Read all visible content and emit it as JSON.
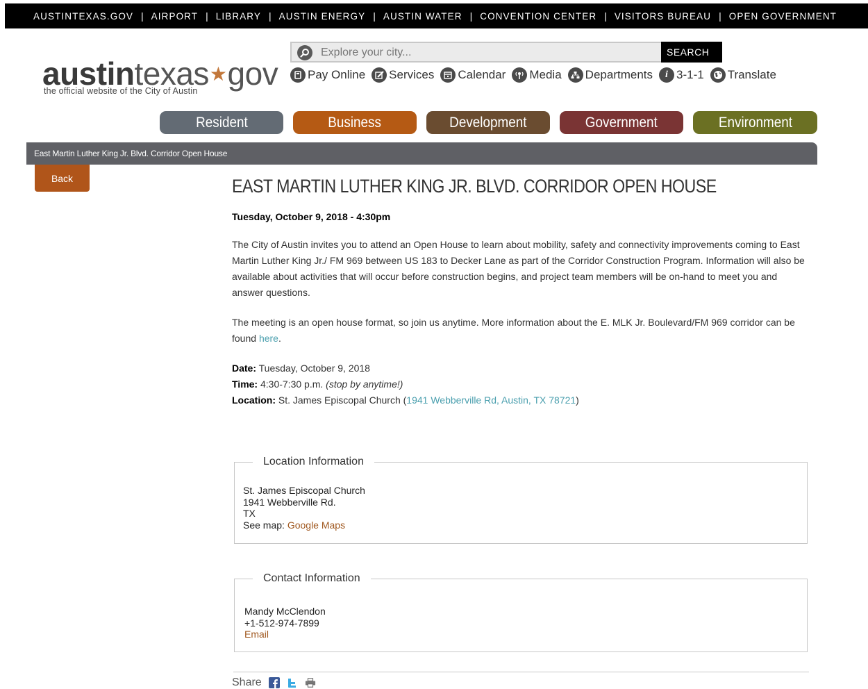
{
  "topbar": {
    "links": [
      "AUSTINTEXAS.GOV",
      "AIRPORT",
      "LIBRARY",
      "AUSTIN ENERGY",
      "AUSTIN WATER",
      "CONVENTION CENTER",
      "VISITORS BUREAU",
      "OPEN GOVERNMENT"
    ],
    "separator": "|"
  },
  "logo": {
    "part1": "austin",
    "part2": "texas",
    "star": "★",
    "part3": "gov",
    "tagline": "the official website of the City of Austin"
  },
  "search": {
    "placeholder": "Explore your city...",
    "button": "SEARCH"
  },
  "quicklinks": [
    {
      "label": "Pay Online",
      "icon": "pay-online-icon"
    },
    {
      "label": "Services",
      "icon": "services-icon"
    },
    {
      "label": "Calendar",
      "icon": "calendar-icon"
    },
    {
      "label": "Media",
      "icon": "media-icon"
    },
    {
      "label": "Departments",
      "icon": "departments-icon"
    },
    {
      "label": "3-1-1",
      "icon": "info-icon"
    },
    {
      "label": "Translate",
      "icon": "globe-icon"
    }
  ],
  "nav": {
    "tabs": [
      {
        "label": "Resident",
        "color": "#636b74"
      },
      {
        "label": "Business",
        "color": "#b55a14"
      },
      {
        "label": "Development",
        "color": "#6a4c30"
      },
      {
        "label": "Government",
        "color": "#7a3434"
      },
      {
        "label": "Environment",
        "color": "#6b7023"
      }
    ]
  },
  "breadcrumb": "East Martin Luther King Jr. Blvd. Corridor Open House",
  "back_button": "Back",
  "event": {
    "title": "EAST MARTIN LUTHER KING JR. BLVD. CORRIDOR OPEN HOUSE",
    "datetime": "Tuesday, October 9, 2018 - 4:30pm",
    "para1": "The City of Austin invites you to attend an Open House to learn about mobility, safety and connectivity improvements coming to East Martin Luther King Jr./ FM 969 between US 183 to Decker Lane as part of the Corridor Construction Program. Information will also be available about activities that will occur before construction begins, and project team members will be on-hand to meet you and answer questions.",
    "para2_text": "The meeting is an open house format, so join us anytime. More information about the E. MLK Jr. Boulevard/FM 969 corridor can be found ",
    "para2_link": "here",
    "para2_end": ".",
    "date_label": "Date:",
    "date_value": " Tuesday, October 9, 2018",
    "time_label": "Time:",
    "time_value": " 4:30-7:30 p.m. ",
    "time_note": "(stop by anytime!)",
    "location_label": "Location:",
    "location_value": " St. James Episcopal Church (",
    "location_link": "1941 Webberville Rd, Austin, TX 78721",
    "location_end": ")"
  },
  "location_info": {
    "legend": "Location Information",
    "name": "St. James Episcopal Church",
    "street": "1941 Webberville Rd.",
    "state": "TX",
    "map_label": "See map: ",
    "map_link": "Google Maps"
  },
  "contact_info": {
    "legend": "Contact Information",
    "name": "Mandy McClendon",
    "phone": "+1-512-974-7899",
    "email_link": "Email"
  },
  "share": {
    "label": "Share",
    "icons": [
      "facebook-icon",
      "twitter-icon",
      "print-icon"
    ]
  }
}
